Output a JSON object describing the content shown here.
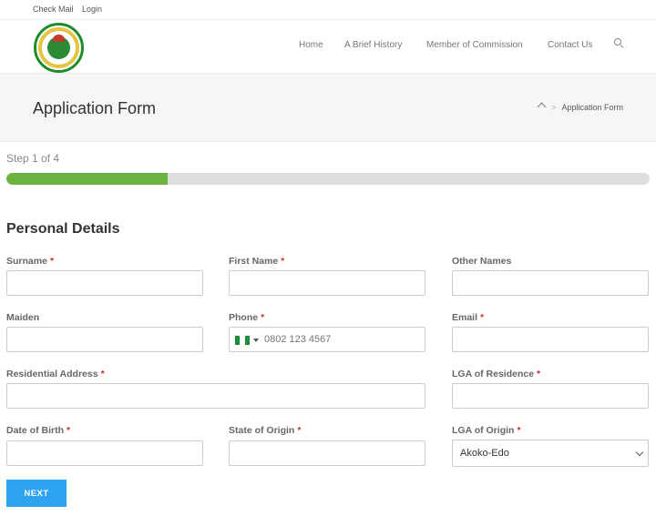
{
  "topbar": {
    "links": [
      "Check Mail",
      "Login"
    ]
  },
  "nav": {
    "items": [
      "Home",
      "A Brief History",
      "Member of Commission",
      "Contact Us"
    ],
    "search_icon": "search-icon"
  },
  "title_bar": {
    "title": "Application Form",
    "breadcrumb": {
      "separator": ">",
      "current": "Application Form"
    }
  },
  "progress": {
    "label": "Step 1 of 4",
    "fraction": 0.25,
    "fill_color": "#6db33f"
  },
  "form": {
    "section_title": "Personal Details",
    "required_marker": "*",
    "fields": {
      "surname": {
        "label": "Surname",
        "value": ""
      },
      "first_name": {
        "label": "First Name",
        "value": ""
      },
      "other_names": {
        "label": "Other Names",
        "value": ""
      },
      "maiden": {
        "label": "Maiden",
        "value": ""
      },
      "phone": {
        "label": "Phone",
        "placeholder": "0802 123 4567",
        "flag": "nigeria-flag-icon"
      },
      "email": {
        "label": "Email",
        "value": ""
      },
      "residential_address": {
        "label": "Residential Address",
        "value": ""
      },
      "lga_of_residence": {
        "label": "LGA of Residence",
        "value": ""
      },
      "date_of_birth": {
        "label": "Date of Birth",
        "value": ""
      },
      "state_of_origin": {
        "label": "State of Origin",
        "value": ""
      },
      "lga_of_origin": {
        "label": "LGA of Origin",
        "selected": "Akoko-Edo"
      }
    },
    "next_button": "NEXT"
  },
  "colors": {
    "accent": "#2ea3f2",
    "required": "#c0392b",
    "logo_green": "#1e8c2a"
  }
}
